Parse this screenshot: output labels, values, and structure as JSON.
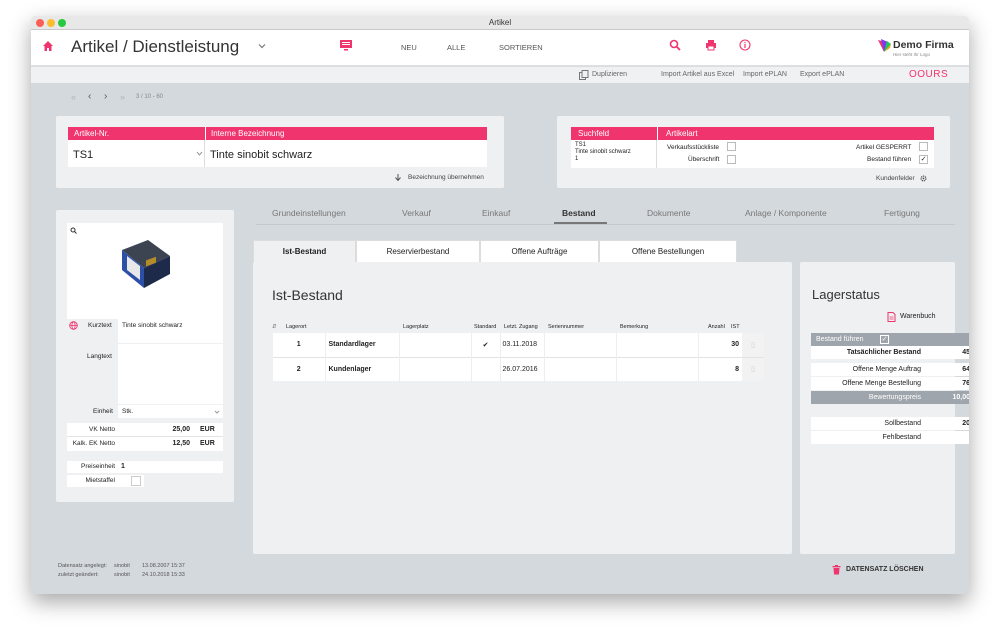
{
  "window": {
    "title": "Artikel"
  },
  "header": {
    "title": "Artikel / Dienstleistung",
    "nav": [
      "NEU",
      "ALLE",
      "SORTIEREN"
    ],
    "company_name": "Demo Firma",
    "company_tagline": "Hier steht Ihr Logo"
  },
  "subheader": {
    "duplicate": "Duplizieren",
    "import_excel": "Import Artikel aus Excel",
    "import_eplan": "Import ePLAN",
    "export_eplan": "Export ePLAN",
    "brand": "OOURS"
  },
  "pager": {
    "text": "3 / 10 - 60"
  },
  "article": {
    "nr_label": "Artikel-Nr.",
    "nr_value": "TS1",
    "intern_label": "Interne Bezeichnung",
    "intern_value": "Tinte sinobit schwarz",
    "take_name": "Bezeichnung übernehmen"
  },
  "search": {
    "suchfeld_label": "Suchfeld",
    "suchfeld_lines": [
      "TS1",
      "Tinte sinobit schwarz",
      "1"
    ],
    "artikelart_label": "Artikelart",
    "verkaufsstueckliste": "Verkaufsstückliste",
    "ueberschrift": "Überschrift",
    "gesperrt": "Artikel GESPERRT",
    "bestand_fuehren": "Bestand führen",
    "kundenfelder": "Kundenfelder"
  },
  "tabs": [
    "Grundeinstellungen",
    "Verkauf",
    "Einkauf",
    "Bestand",
    "Dokumente",
    "Anlage / Komponente",
    "Fertigung"
  ],
  "active_tab": "Bestand",
  "subtabs": [
    "Ist-Bestand",
    "Reservierbestand",
    "Offene Aufträge",
    "Offene Bestellungen"
  ],
  "left_panel": {
    "kurztext_label": "Kurztext",
    "kurztext_value": "Tinte sinobit schwarz",
    "langtext_label": "Langtext",
    "einheit_label": "Einheit",
    "einheit_value": "Stk.",
    "vk_label": "VK Netto",
    "vk_value": "25,00",
    "vk_cur": "EUR",
    "ek_label": "Kalk. EK Netto",
    "ek_value": "12,50",
    "ek_cur": "EUR",
    "preiseinheit_label": "Preiseinheit",
    "preiseinheit_value": "1",
    "mietstaffel_label": "Mietstaffel"
  },
  "ist": {
    "heading": "Ist-Bestand",
    "columns": [
      "Lagerort",
      "Lagerplatz",
      "Standard",
      "Letzt. Zugang",
      "Seriennummer",
      "Bemerkung",
      "Anzahl",
      "IST"
    ],
    "rows": [
      {
        "nr": "1",
        "lagerort": "Standardlager",
        "lagerplatz": "",
        "standard": "✔",
        "zugang": "03.11.2018",
        "serie": "",
        "bemerkung": "",
        "anzahl": "30"
      },
      {
        "nr": "2",
        "lagerort": "Kundenlager",
        "lagerplatz": "",
        "standard": "",
        "zugang": "26.07.2016",
        "serie": "",
        "bemerkung": "",
        "anzahl": "8"
      }
    ]
  },
  "lagerstatus": {
    "heading": "Lagerstatus",
    "warenbuch": "Warenbuch",
    "bestand_fuehren": "Bestand führen",
    "tats_label": "Tatsächlicher Bestand",
    "tats_value": "45",
    "auftrag_label": "Offene Menge Auftrag",
    "auftrag_value": "64",
    "bestellung_label": "Offene Menge Bestellung",
    "bestellung_value": "76",
    "bewertung_label": "Bewertungspreis",
    "bewertung_value": "10,00",
    "soll_label": "Sollbestand",
    "soll_value": "20",
    "fehl_label": "Fehlbestand"
  },
  "footer": {
    "created_label": "Datensatz angelegt:",
    "created_user": "sinobit",
    "created_date": "13.08.2007 15:37",
    "changed_label": "zuletzt geändert:",
    "changed_user": "sinobit",
    "changed_date": "24.10.2018 15:33",
    "delete": "DATENSATZ LÖSCHEN"
  },
  "colors": {
    "accent": "#f0356e",
    "background": "#d4d9de"
  }
}
